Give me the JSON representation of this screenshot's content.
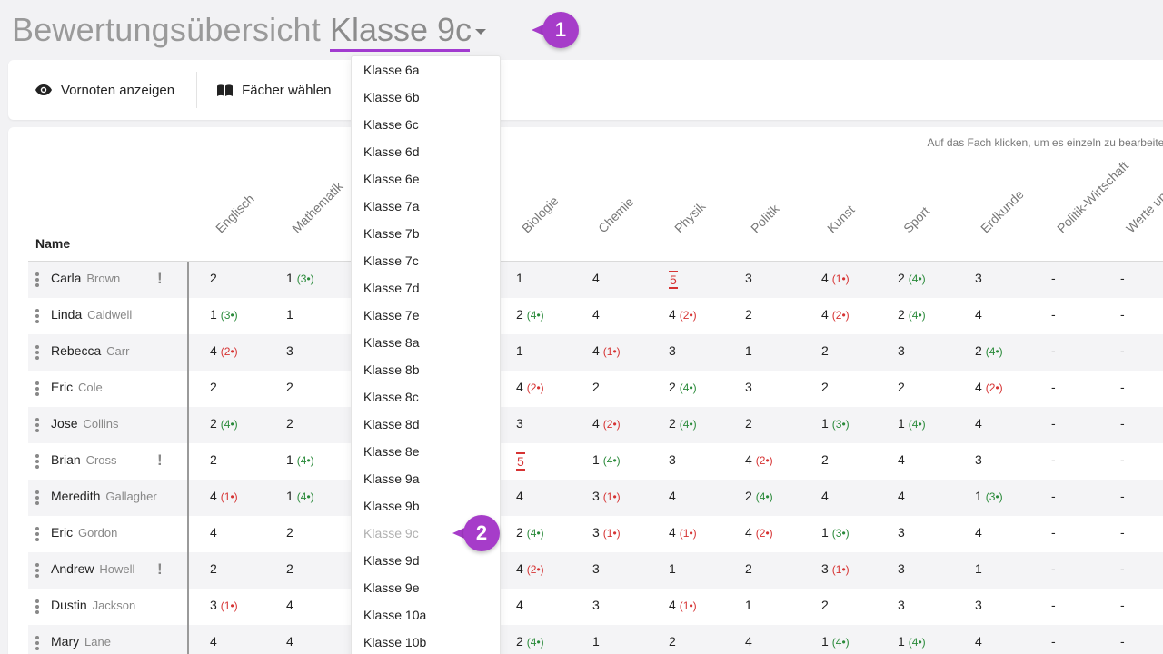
{
  "header": {
    "title": "Bewertungsübersicht",
    "selected_class": "Klasse 9c"
  },
  "callouts": [
    "1",
    "2"
  ],
  "toolbar": {
    "show_pregrades": "Vornoten anzeigen",
    "choose_subjects": "Fächer wählen"
  },
  "hint": "Auf das Fach klicken, um es einzeln zu bearbeiten",
  "table": {
    "name_header": "Name",
    "subjects": [
      "Englisch",
      "Mathematik",
      "Biologie",
      "Chemie",
      "Physik",
      "Politik",
      "Kunst",
      "Sport",
      "Erdkunde",
      "Politik-Wirtschaft",
      "Werte un"
    ],
    "rows": [
      {
        "first": "Carla",
        "last": "Brown",
        "warn": true,
        "grades": [
          [
            "2",
            ""
          ],
          [
            "1",
            "(3•)",
            "good"
          ],
          [
            "1",
            ""
          ],
          [
            "4",
            ""
          ],
          [
            "5",
            "",
            "fail"
          ],
          [
            "3",
            ""
          ],
          [
            "4",
            "(1•)",
            "bad"
          ],
          [
            "2",
            "(4•)",
            "good"
          ],
          [
            "3",
            ""
          ],
          [
            "-",
            ""
          ],
          [
            "-",
            ""
          ]
        ]
      },
      {
        "first": "Linda",
        "last": "Caldwell",
        "warn": false,
        "grades": [
          [
            "1",
            "(3•)",
            "good"
          ],
          [
            "1",
            ""
          ],
          [
            "2",
            "(4•)",
            "good"
          ],
          [
            "4",
            ""
          ],
          [
            "4",
            "(2•)",
            "bad"
          ],
          [
            "2",
            ""
          ],
          [
            "4",
            "(2•)",
            "bad"
          ],
          [
            "2",
            "(4•)",
            "good"
          ],
          [
            "4",
            ""
          ],
          [
            "-",
            ""
          ],
          [
            "-",
            ""
          ]
        ]
      },
      {
        "first": "Rebecca",
        "last": "Carr",
        "warn": false,
        "grades": [
          [
            "4",
            "(2•)",
            "bad"
          ],
          [
            "3",
            ""
          ],
          [
            "1",
            ""
          ],
          [
            "4",
            "(1•)",
            "bad"
          ],
          [
            "3",
            ""
          ],
          [
            "1",
            ""
          ],
          [
            "2",
            ""
          ],
          [
            "3",
            ""
          ],
          [
            "2",
            "(4•)",
            "good"
          ],
          [
            "-",
            ""
          ],
          [
            "-",
            ""
          ]
        ]
      },
      {
        "first": "Eric",
        "last": "Cole",
        "warn": false,
        "grades": [
          [
            "2",
            ""
          ],
          [
            "2",
            ""
          ],
          [
            "4",
            "(2•)",
            "bad"
          ],
          [
            "2",
            ""
          ],
          [
            "2",
            "(4•)",
            "good"
          ],
          [
            "3",
            ""
          ],
          [
            "2",
            ""
          ],
          [
            "2",
            ""
          ],
          [
            "4",
            "(2•)",
            "bad"
          ],
          [
            "-",
            ""
          ],
          [
            "-",
            ""
          ]
        ]
      },
      {
        "first": "Jose",
        "last": "Collins",
        "warn": false,
        "grades": [
          [
            "2",
            "(4•)",
            "good"
          ],
          [
            "2",
            ""
          ],
          [
            "3",
            ""
          ],
          [
            "4",
            "(2•)",
            "bad"
          ],
          [
            "2",
            "(4•)",
            "good"
          ],
          [
            "2",
            ""
          ],
          [
            "1",
            "(3•)",
            "good"
          ],
          [
            "1",
            "(4•)",
            "good"
          ],
          [
            "4",
            ""
          ],
          [
            "-",
            ""
          ],
          [
            "-",
            ""
          ]
        ]
      },
      {
        "first": "Brian",
        "last": "Cross",
        "warn": true,
        "grades": [
          [
            "2",
            ""
          ],
          [
            "1",
            "(4•)",
            "good"
          ],
          [
            "5",
            "",
            "fail"
          ],
          [
            "1",
            "(4•)",
            "good"
          ],
          [
            "3",
            ""
          ],
          [
            "4",
            "(2•)",
            "bad"
          ],
          [
            "2",
            ""
          ],
          [
            "4",
            ""
          ],
          [
            "3",
            ""
          ],
          [
            "-",
            ""
          ],
          [
            "-",
            ""
          ]
        ]
      },
      {
        "first": "Meredith",
        "last": "Gallagher",
        "warn": false,
        "grades": [
          [
            "4",
            "(1•)",
            "bad"
          ],
          [
            "1",
            "(4•)",
            "good"
          ],
          [
            "4",
            ""
          ],
          [
            "3",
            "(1•)",
            "bad"
          ],
          [
            "4",
            ""
          ],
          [
            "2",
            "(4•)",
            "good"
          ],
          [
            "4",
            ""
          ],
          [
            "4",
            ""
          ],
          [
            "1",
            "(3•)",
            "good"
          ],
          [
            "-",
            ""
          ],
          [
            "-",
            ""
          ]
        ]
      },
      {
        "first": "Eric",
        "last": "Gordon",
        "warn": false,
        "grades": [
          [
            "4",
            ""
          ],
          [
            "2",
            ""
          ],
          [
            "2",
            "(4•)",
            "good"
          ],
          [
            "3",
            "(1•)",
            "bad"
          ],
          [
            "4",
            "(1•)",
            "bad"
          ],
          [
            "4",
            "(2•)",
            "bad"
          ],
          [
            "1",
            "(3•)",
            "good"
          ],
          [
            "3",
            ""
          ],
          [
            "4",
            ""
          ],
          [
            "-",
            ""
          ],
          [
            "-",
            ""
          ]
        ]
      },
      {
        "first": "Andrew",
        "last": "Howell",
        "warn": true,
        "grades": [
          [
            "2",
            ""
          ],
          [
            "2",
            ""
          ],
          [
            "4",
            "(2•)",
            "bad"
          ],
          [
            "3",
            ""
          ],
          [
            "1",
            ""
          ],
          [
            "2",
            ""
          ],
          [
            "3",
            "(1•)",
            "bad"
          ],
          [
            "3",
            ""
          ],
          [
            "1",
            ""
          ],
          [
            "-",
            ""
          ],
          [
            "-",
            ""
          ]
        ]
      },
      {
        "first": "Dustin",
        "last": "Jackson",
        "warn": false,
        "grades": [
          [
            "3",
            "(1•)",
            "bad"
          ],
          [
            "4",
            ""
          ],
          [
            "4",
            ""
          ],
          [
            "3",
            ""
          ],
          [
            "4",
            "(1•)",
            "bad"
          ],
          [
            "1",
            ""
          ],
          [
            "2",
            ""
          ],
          [
            "3",
            ""
          ],
          [
            "3",
            ""
          ],
          [
            "-",
            ""
          ],
          [
            "-",
            ""
          ]
        ]
      },
      {
        "first": "Mary",
        "last": "Lane",
        "warn": false,
        "grades": [
          [
            "4",
            ""
          ],
          [
            "4",
            ""
          ],
          [
            "2",
            "(4•)",
            "good"
          ],
          [
            "1",
            ""
          ],
          [
            "2",
            ""
          ],
          [
            "4",
            ""
          ],
          [
            "1",
            "(4•)",
            "good"
          ],
          [
            "1",
            "(4•)",
            "good"
          ],
          [
            "4",
            ""
          ],
          [
            "-",
            ""
          ],
          [
            "-",
            ""
          ]
        ]
      }
    ]
  },
  "dropdown": {
    "items": [
      "Klasse 6a",
      "Klasse 6b",
      "Klasse 6c",
      "Klasse 6d",
      "Klasse 6e",
      "Klasse 7a",
      "Klasse 7b",
      "Klasse 7c",
      "Klasse 7d",
      "Klasse 7e",
      "Klasse 8a",
      "Klasse 8b",
      "Klasse 8c",
      "Klasse 8d",
      "Klasse 8e",
      "Klasse 9a",
      "Klasse 9b",
      "Klasse 9c",
      "Klasse 9d",
      "Klasse 9e",
      "Klasse 10a",
      "Klasse 10b"
    ],
    "current": "Klasse 9c"
  },
  "colors": {
    "accent": "#a63cc9",
    "good": "#2a8a3a",
    "bad": "#d63333"
  }
}
